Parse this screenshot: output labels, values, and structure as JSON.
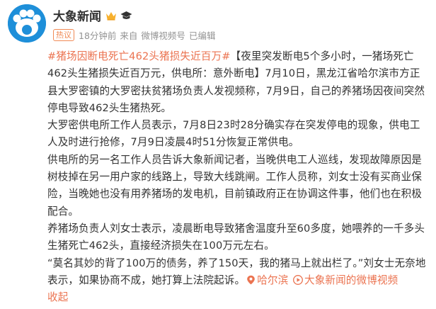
{
  "header": {
    "name": "大象新闻",
    "tag": "热议",
    "time": "18分钟前",
    "source_prefix": "来自",
    "source": "微博视频号",
    "edited": "已编辑"
  },
  "post": {
    "topic": "#猪场因断电死亡462头猪损失近百万#",
    "p1": "【夜里突发断电5个多小时，一猪场死亡462头生猪损失近百万元，供电所：意外断电】7月10日，黑龙江省哈尔滨市方正县大罗密镇的大罗密扶贫猪场负责人发视频称，7月9日，自己的养猪场因夜间突然停电导致462头生猪热死。",
    "p2": "大罗密供电所工作人员表示，7月8日23时28分确实存在突发停电的现象，供电工人及时进行抢修，7月9日凌晨4时51分恢复正常供电。",
    "p3": "供电所的另一名工作人员告诉大象新闻记者，当晚供电工人巡线，发现故障原因是树枝掉在另一用户家的线路上，导致大线跳闸。工作人员称，刘女士没有买商业保险，当晚她也没有用养猪场的发电机，目前镇政府正在协调这件事，他们也在积极配合。",
    "p4": "养猪场负责人刘女士表示，凌晨断电导致猪舍温度升至60多度，她喂养的一千多头生猪死亡462头，直接经济损失在100万元左右。",
    "p5": "“莫名其妙的背了100万的债务，养了150天，我的猪马上就出栏了。”刘女士无奈地表示，如果协商不成，她打算上法院起诉。",
    "location": "哈尔滨",
    "video_link": "大象新闻的微博视频",
    "collapse": "收起"
  },
  "colors": {
    "link": "#eb7350",
    "meta": "#939393",
    "avatar": "#1e8fd9"
  }
}
